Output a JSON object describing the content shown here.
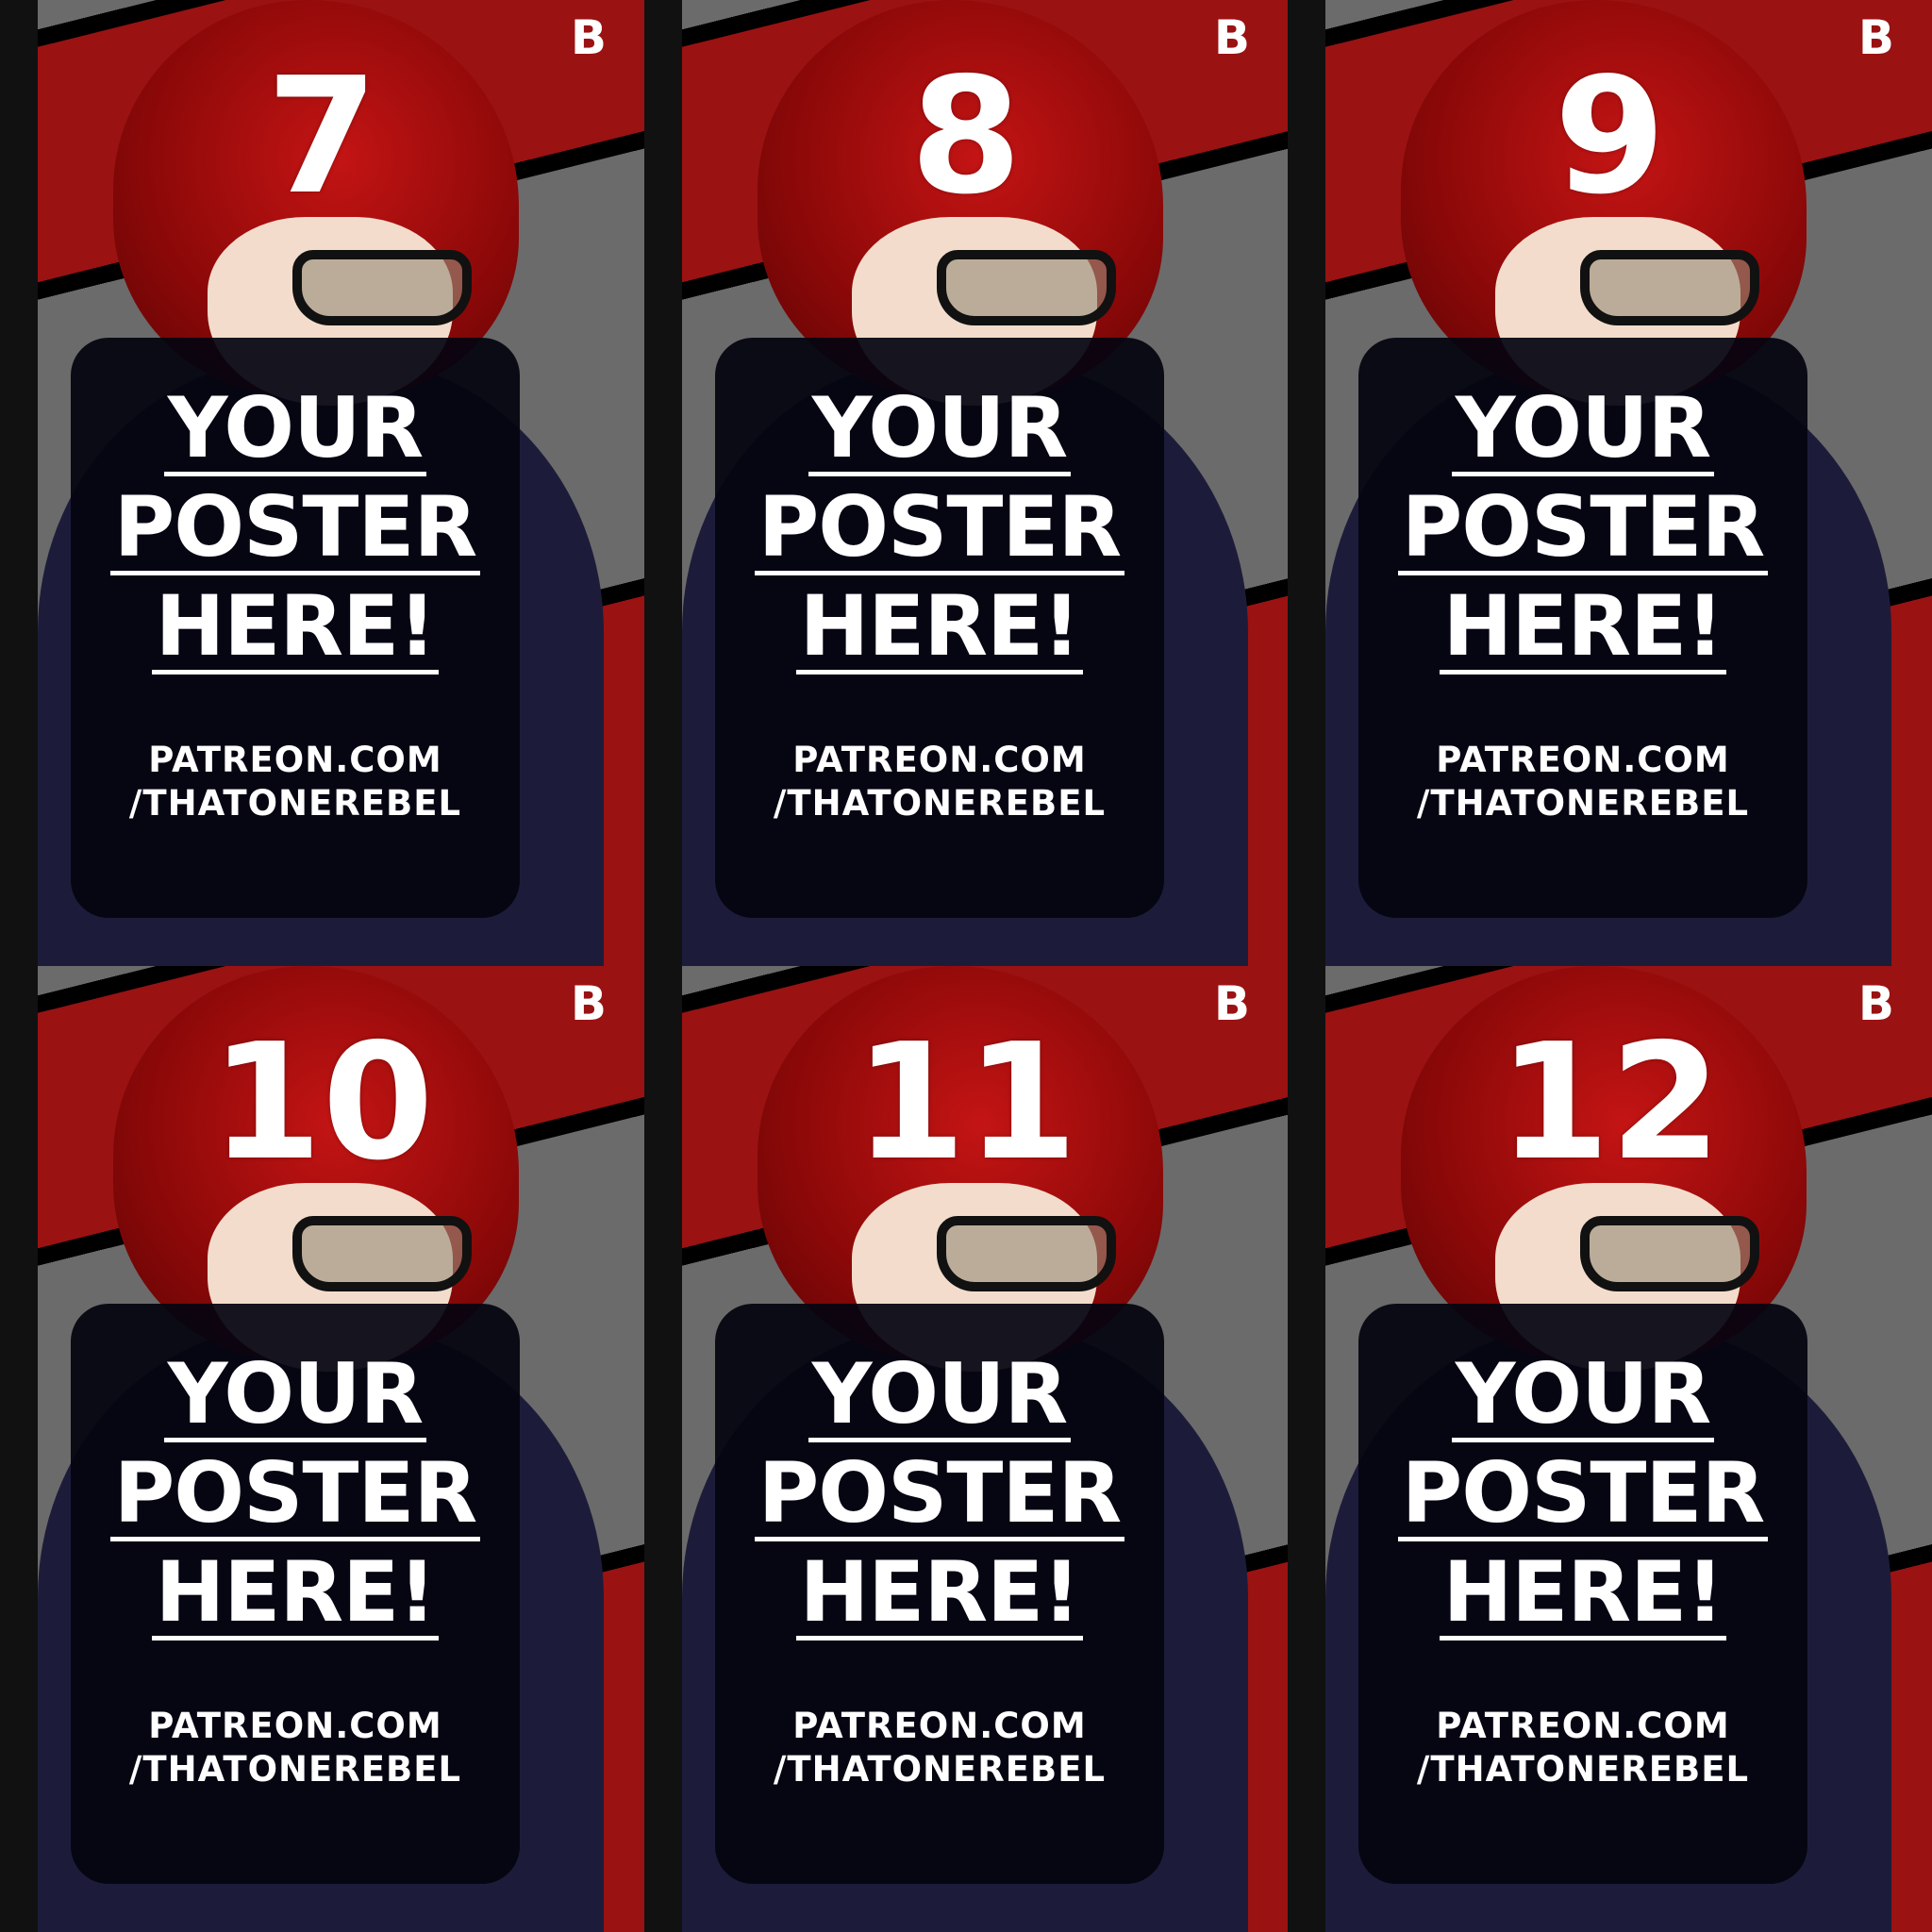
{
  "posters": [
    {
      "number": "7"
    },
    {
      "number": "8"
    },
    {
      "number": "9"
    },
    {
      "number": "10"
    },
    {
      "number": "11"
    },
    {
      "number": "12"
    }
  ],
  "badge": "B",
  "headline": [
    "YOUR",
    "POSTER",
    "HERE!"
  ],
  "url": [
    "PATREON.COM",
    "/THATONEREBEL"
  ],
  "colors": {
    "background": "#6b6b6b",
    "stripe": "#9a1212",
    "card": "#040410",
    "text": "#ffffff"
  }
}
